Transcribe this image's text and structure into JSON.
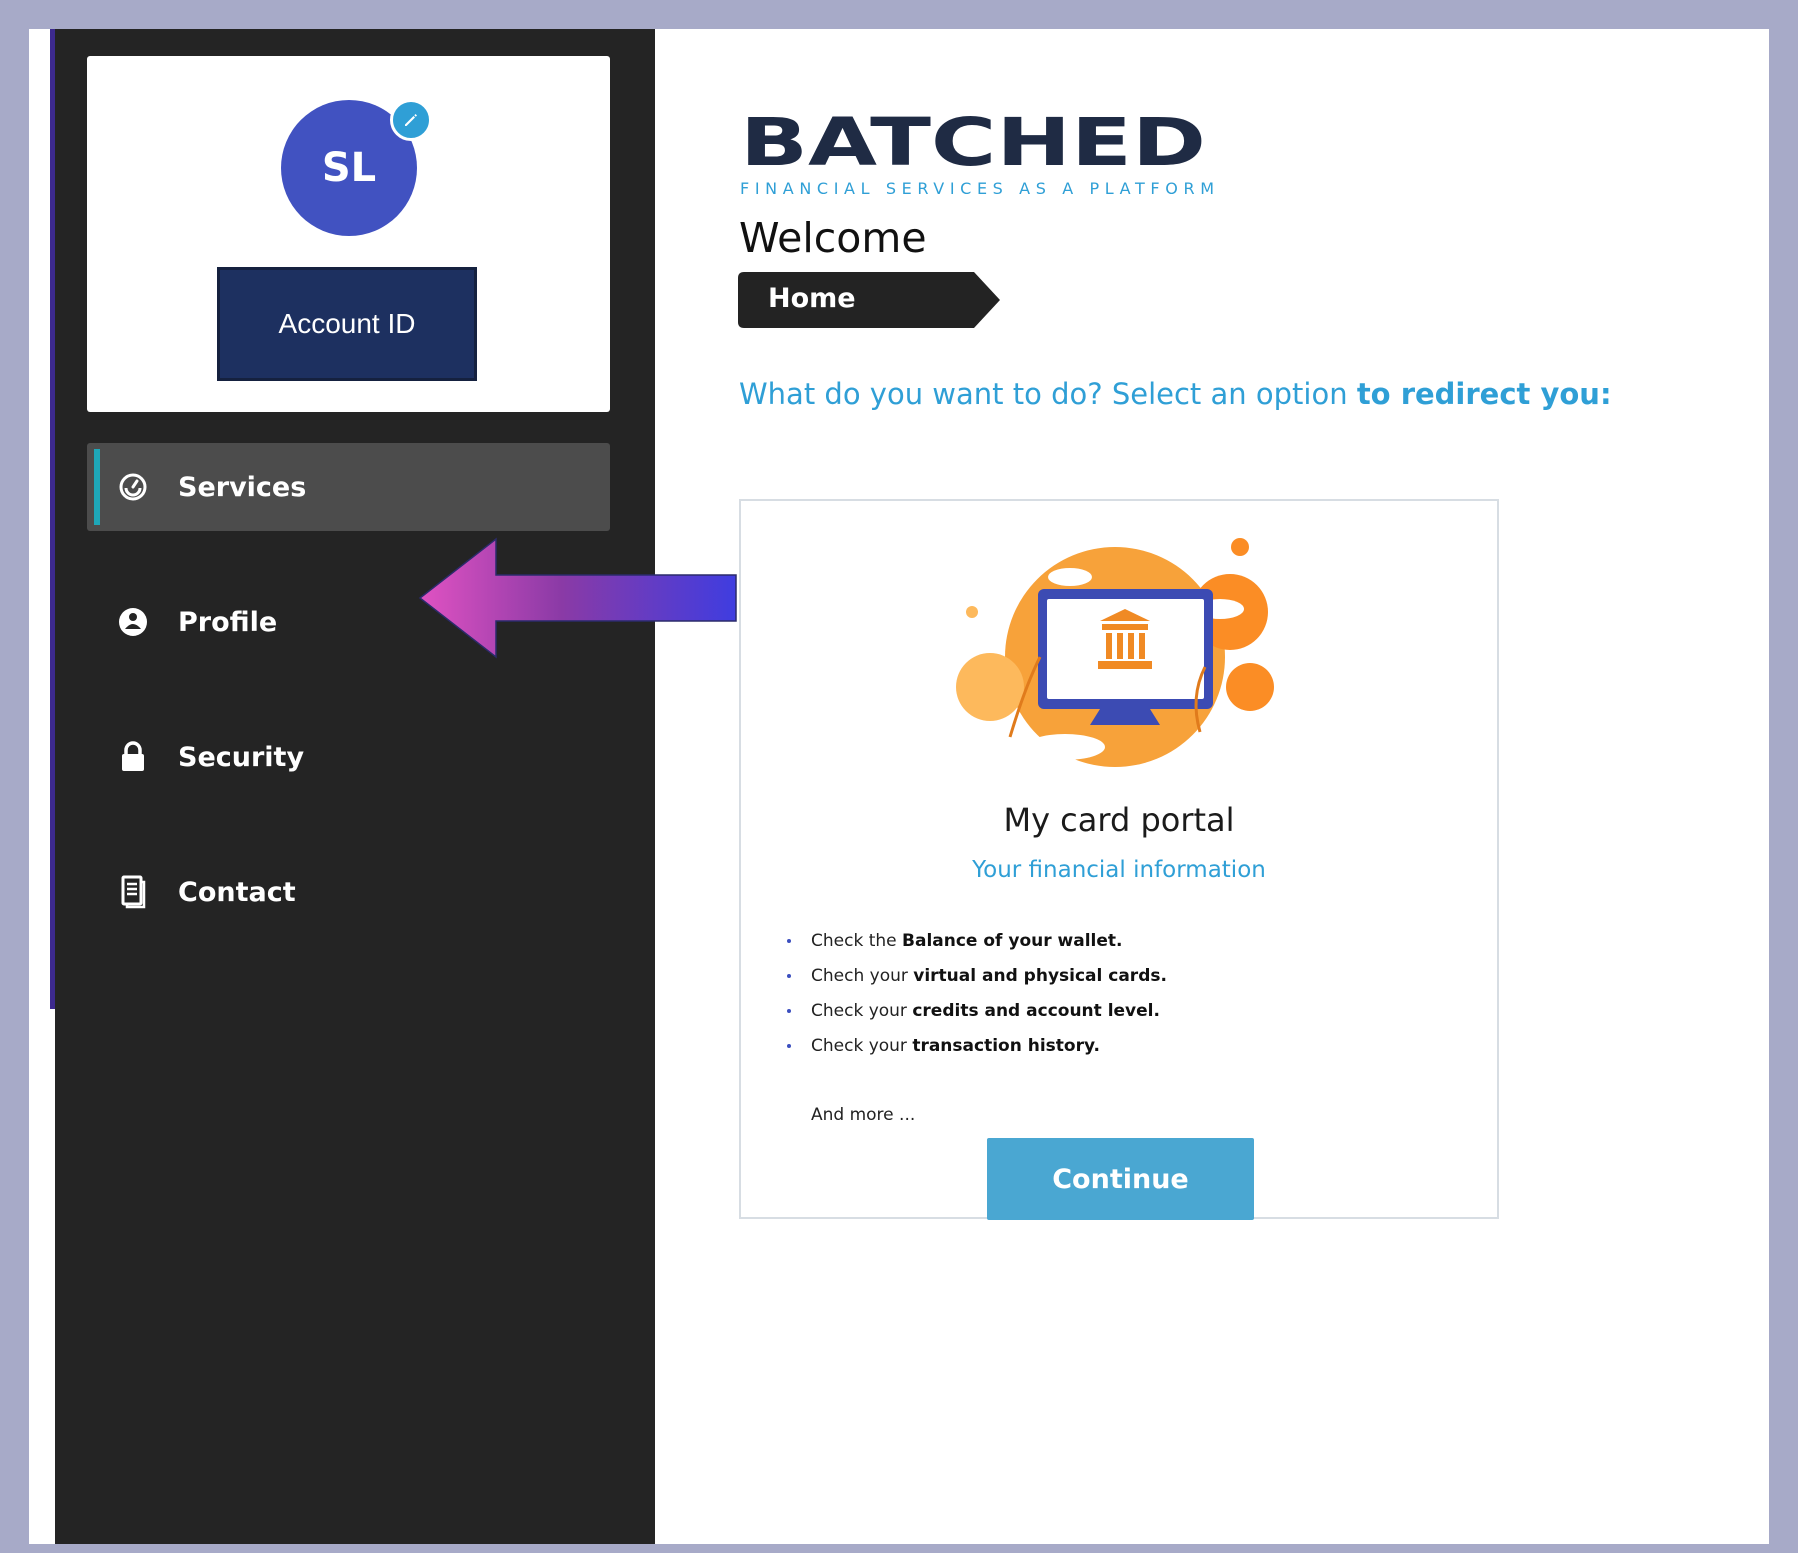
{
  "profile": {
    "initials": "SL",
    "account_button": "Account ID",
    "edit_icon": "pencil-icon"
  },
  "sidebar": {
    "items": [
      {
        "label": "Services",
        "icon": "gauge-icon",
        "active": true
      },
      {
        "label": "Profile",
        "icon": "user-circle-icon",
        "active": false
      },
      {
        "label": "Security",
        "icon": "lock-icon",
        "active": false
      },
      {
        "label": "Contact",
        "icon": "document-icon",
        "active": false
      }
    ]
  },
  "brand": {
    "name": "BATCHED",
    "tagline": "FINANCIAL SERVICES AS A PLATFORM"
  },
  "main": {
    "welcome": "Welcome",
    "breadcrumb": "Home",
    "prompt_plain": "What do you want to do? Select an option ",
    "prompt_bold": "to redirect you:"
  },
  "card": {
    "title": "My card portal",
    "subtitle": "Your financial information",
    "features": [
      {
        "plain": "Check the ",
        "bold": "Balance of your wallet."
      },
      {
        "plain": "Chech your ",
        "bold": "virtual and physical cards."
      },
      {
        "plain": "Check your ",
        "bold": "credits and account level."
      },
      {
        "plain": "Check your ",
        "bold": "transaction history."
      }
    ],
    "more": "And more ...",
    "button": "Continue"
  },
  "colors": {
    "sidebar_bg": "#242424",
    "accent_blue": "#2f9fd6",
    "avatar": "#4152c1",
    "account_button": "#1d3060",
    "continue_button": "#4aa7d2",
    "active_indicator": "#1ea7b8",
    "arrow_start": "#e052c2",
    "arrow_end": "#3f3de0"
  }
}
